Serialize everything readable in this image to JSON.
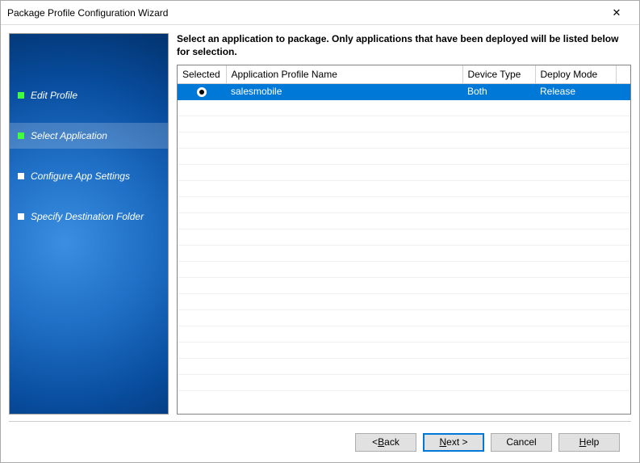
{
  "window": {
    "title": "Package Profile Configuration Wizard"
  },
  "sidebar": {
    "steps": [
      {
        "label": "Edit Profile",
        "status": "done"
      },
      {
        "label": "Select Application",
        "status": "done"
      },
      {
        "label": "Configure App Settings",
        "status": "pending"
      },
      {
        "label": "Specify Destination Folder",
        "status": "pending"
      }
    ],
    "activeIndex": 1
  },
  "main": {
    "instruction": "Select an application to package. Only applications that have been deployed will be listed below for selection.",
    "columns": {
      "selected": "Selected",
      "name": "Application Profile Name",
      "device": "Device Type",
      "deploy": "Deploy Mode"
    },
    "rows": [
      {
        "selected": true,
        "name": "salesmobile",
        "device": "Both",
        "deploy": "Release"
      }
    ]
  },
  "footer": {
    "back_prefix": "< ",
    "back_accel": "B",
    "back_suffix": "ack",
    "next_accel": "N",
    "next_suffix": "ext >",
    "cancel": "Cancel",
    "help_accel": "H",
    "help_suffix": "elp"
  }
}
